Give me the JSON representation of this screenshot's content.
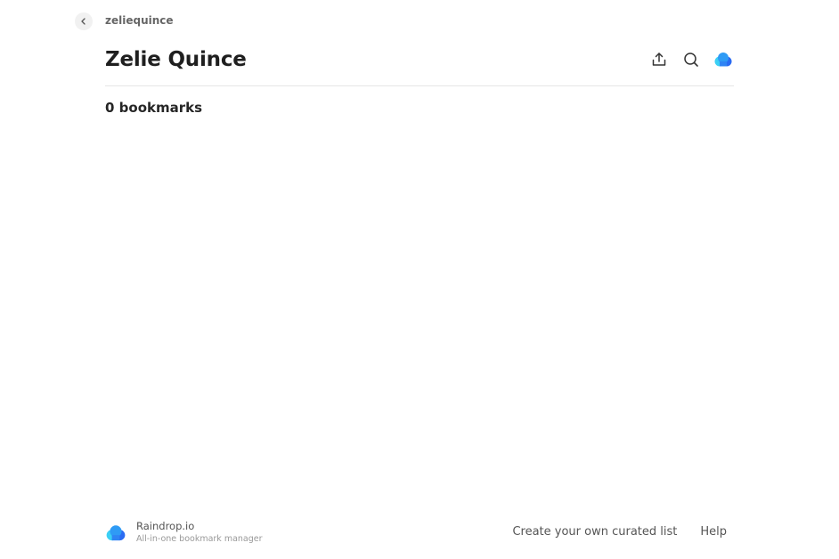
{
  "breadcrumb": {
    "back_icon": "chevron-left-icon",
    "label": "zeliequince"
  },
  "header": {
    "title": "Zelie Quince",
    "actions": {
      "share_icon": "share-upload-icon",
      "search_icon": "search-icon",
      "brand_icon": "raindrop-cloud-icon"
    }
  },
  "collection": {
    "count_label": "0 bookmarks"
  },
  "footer": {
    "brand_name": "Raindrop.io",
    "brand_tagline": "All-in-one bookmark manager",
    "create_link": "Create your own curated list",
    "help_link": "Help"
  },
  "colors": {
    "cloud_light": "#3bd0f5",
    "cloud_dark": "#2a6bf2",
    "cloud_mid": "#2f9bf5",
    "text_primary": "#1f1f1f",
    "text_muted": "#666666",
    "divider": "#e6e6e6"
  }
}
